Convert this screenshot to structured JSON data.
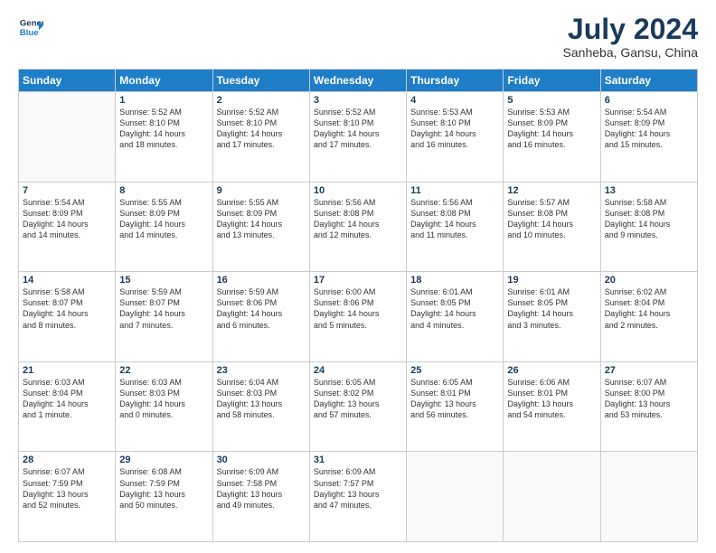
{
  "logo": {
    "line1": "General",
    "line2": "Blue"
  },
  "title": {
    "month_year": "July 2024",
    "location": "Sanheba, Gansu, China"
  },
  "weekdays": [
    "Sunday",
    "Monday",
    "Tuesday",
    "Wednesday",
    "Thursday",
    "Friday",
    "Saturday"
  ],
  "weeks": [
    [
      {
        "day": "",
        "info": ""
      },
      {
        "day": "1",
        "info": "Sunrise: 5:52 AM\nSunset: 8:10 PM\nDaylight: 14 hours\nand 18 minutes."
      },
      {
        "day": "2",
        "info": "Sunrise: 5:52 AM\nSunset: 8:10 PM\nDaylight: 14 hours\nand 17 minutes."
      },
      {
        "day": "3",
        "info": "Sunrise: 5:52 AM\nSunset: 8:10 PM\nDaylight: 14 hours\nand 17 minutes."
      },
      {
        "day": "4",
        "info": "Sunrise: 5:53 AM\nSunset: 8:10 PM\nDaylight: 14 hours\nand 16 minutes."
      },
      {
        "day": "5",
        "info": "Sunrise: 5:53 AM\nSunset: 8:09 PM\nDaylight: 14 hours\nand 16 minutes."
      },
      {
        "day": "6",
        "info": "Sunrise: 5:54 AM\nSunset: 8:09 PM\nDaylight: 14 hours\nand 15 minutes."
      }
    ],
    [
      {
        "day": "7",
        "info": "Sunrise: 5:54 AM\nSunset: 8:09 PM\nDaylight: 14 hours\nand 14 minutes."
      },
      {
        "day": "8",
        "info": "Sunrise: 5:55 AM\nSunset: 8:09 PM\nDaylight: 14 hours\nand 14 minutes."
      },
      {
        "day": "9",
        "info": "Sunrise: 5:55 AM\nSunset: 8:09 PM\nDaylight: 14 hours\nand 13 minutes."
      },
      {
        "day": "10",
        "info": "Sunrise: 5:56 AM\nSunset: 8:08 PM\nDaylight: 14 hours\nand 12 minutes."
      },
      {
        "day": "11",
        "info": "Sunrise: 5:56 AM\nSunset: 8:08 PM\nDaylight: 14 hours\nand 11 minutes."
      },
      {
        "day": "12",
        "info": "Sunrise: 5:57 AM\nSunset: 8:08 PM\nDaylight: 14 hours\nand 10 minutes."
      },
      {
        "day": "13",
        "info": "Sunrise: 5:58 AM\nSunset: 8:08 PM\nDaylight: 14 hours\nand 9 minutes."
      }
    ],
    [
      {
        "day": "14",
        "info": "Sunrise: 5:58 AM\nSunset: 8:07 PM\nDaylight: 14 hours\nand 8 minutes."
      },
      {
        "day": "15",
        "info": "Sunrise: 5:59 AM\nSunset: 8:07 PM\nDaylight: 14 hours\nand 7 minutes."
      },
      {
        "day": "16",
        "info": "Sunrise: 5:59 AM\nSunset: 8:06 PM\nDaylight: 14 hours\nand 6 minutes."
      },
      {
        "day": "17",
        "info": "Sunrise: 6:00 AM\nSunset: 8:06 PM\nDaylight: 14 hours\nand 5 minutes."
      },
      {
        "day": "18",
        "info": "Sunrise: 6:01 AM\nSunset: 8:05 PM\nDaylight: 14 hours\nand 4 minutes."
      },
      {
        "day": "19",
        "info": "Sunrise: 6:01 AM\nSunset: 8:05 PM\nDaylight: 14 hours\nand 3 minutes."
      },
      {
        "day": "20",
        "info": "Sunrise: 6:02 AM\nSunset: 8:04 PM\nDaylight: 14 hours\nand 2 minutes."
      }
    ],
    [
      {
        "day": "21",
        "info": "Sunrise: 6:03 AM\nSunset: 8:04 PM\nDaylight: 14 hours\nand 1 minute."
      },
      {
        "day": "22",
        "info": "Sunrise: 6:03 AM\nSunset: 8:03 PM\nDaylight: 14 hours\nand 0 minutes."
      },
      {
        "day": "23",
        "info": "Sunrise: 6:04 AM\nSunset: 8:03 PM\nDaylight: 13 hours\nand 58 minutes."
      },
      {
        "day": "24",
        "info": "Sunrise: 6:05 AM\nSunset: 8:02 PM\nDaylight: 13 hours\nand 57 minutes."
      },
      {
        "day": "25",
        "info": "Sunrise: 6:05 AM\nSunset: 8:01 PM\nDaylight: 13 hours\nand 56 minutes."
      },
      {
        "day": "26",
        "info": "Sunrise: 6:06 AM\nSunset: 8:01 PM\nDaylight: 13 hours\nand 54 minutes."
      },
      {
        "day": "27",
        "info": "Sunrise: 6:07 AM\nSunset: 8:00 PM\nDaylight: 13 hours\nand 53 minutes."
      }
    ],
    [
      {
        "day": "28",
        "info": "Sunrise: 6:07 AM\nSunset: 7:59 PM\nDaylight: 13 hours\nand 52 minutes."
      },
      {
        "day": "29",
        "info": "Sunrise: 6:08 AM\nSunset: 7:59 PM\nDaylight: 13 hours\nand 50 minutes."
      },
      {
        "day": "30",
        "info": "Sunrise: 6:09 AM\nSunset: 7:58 PM\nDaylight: 13 hours\nand 49 minutes."
      },
      {
        "day": "31",
        "info": "Sunrise: 6:09 AM\nSunset: 7:57 PM\nDaylight: 13 hours\nand 47 minutes."
      },
      {
        "day": "",
        "info": ""
      },
      {
        "day": "",
        "info": ""
      },
      {
        "day": "",
        "info": ""
      }
    ]
  ]
}
